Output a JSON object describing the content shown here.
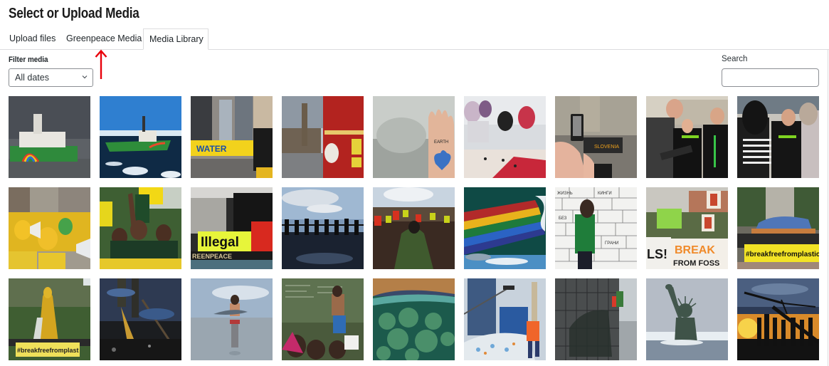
{
  "modal": {
    "title": "Select or Upload Media"
  },
  "tabs": [
    {
      "label": "Upload files",
      "active": false
    },
    {
      "label": "Greenpeace Media",
      "active": false
    },
    {
      "label": "Media Library",
      "active": true
    }
  ],
  "filter": {
    "label": "Filter media",
    "date_select_value": "All dates"
  },
  "search": {
    "label": "Search",
    "value": "",
    "placeholder": ""
  },
  "annotation": {
    "type": "red-arrow-up",
    "points_to": "Greenpeace Media",
    "color": "#e8000b"
  },
  "media_items": [
    {
      "row": 1,
      "col": 1,
      "description": "Greenpeace ship with rainbow hull in harbor under grey sky"
    },
    {
      "row": 1,
      "col": 2,
      "description": "Green Greenpeace ship among Arctic sea ice, blue sky"
    },
    {
      "row": 1,
      "col": 3,
      "description": "City street protest with yellow 'Water is Life' banner"
    },
    {
      "row": 1,
      "col": 4,
      "description": "Big Ben with red London bus and polar bear costume"
    },
    {
      "row": 1,
      "col": 5,
      "description": "Raised palm with 'Planet Earth First' and heart globe drawing"
    },
    {
      "row": 1,
      "col": 6,
      "description": "Women in hijabs working on a large fabric banner"
    },
    {
      "row": 1,
      "col": 7,
      "description": "Hands holding phone photographing protest banner"
    },
    {
      "row": 1,
      "col": 8,
      "description": "Man signing petition with Greenpeace volunteers in black shirts"
    },
    {
      "row": 1,
      "col": 9,
      "description": "Volunteer in Greenpeace shirt collecting signatures"
    },
    {
      "row": 2,
      "col": 1,
      "description": "Protesters in yellow suits with megaphones and barrels"
    },
    {
      "row": 2,
      "col": 2,
      "description": "Young activists cheering at climate march with yellow banner"
    },
    {
      "row": 2,
      "col": 3,
      "description": "Activists with 'Illegal' banner and Greenpeace boom on ship"
    },
    {
      "row": 2,
      "col": 4,
      "description": "Silhouetted people holding hands reflected in water"
    },
    {
      "row": 2,
      "col": 5,
      "description": "Crowd with red and yellow flags at rally"
    },
    {
      "row": 2,
      "col": 6,
      "description": "Rainbow stripes on ship hull with dolphins in waves"
    },
    {
      "row": 2,
      "col": 7,
      "description": "Volunteer in green shirt writing on whiteboard wall"
    },
    {
      "row": 2,
      "col": 8,
      "description": "Protest with 'Break Free From Fossil' banner"
    },
    {
      "row": 2,
      "col": 9,
      "description": "#breakfreefromplastic banner at temple steps"
    },
    {
      "row": 3,
      "col": 1,
      "description": "Golden statue at Batu Caves with #breakfreefromplastic banner"
    },
    {
      "row": 3,
      "col": 2,
      "description": "Oil-polluted water with reflection of legs"
    },
    {
      "row": 3,
      "col": 3,
      "description": "Child holding a fish standing in shallow sea"
    },
    {
      "row": 3,
      "col": 4,
      "description": "Teacher at chalkboard with students raising hands"
    },
    {
      "row": 3,
      "col": 5,
      "description": "Split-level view of coral reef under sunset sky"
    },
    {
      "row": 3,
      "col": 6,
      "description": "Woman dragging a huge sack of plastic bottles in city"
    },
    {
      "row": 3,
      "col": 7,
      "description": "Climbers rappelling down a tall building facade"
    },
    {
      "row": 3,
      "col": 8,
      "description": "Statue of Liberty partially submerged in icy water"
    },
    {
      "row": 3,
      "col": 9,
      "description": "Silhouettes raising a wind turbine at sunset"
    }
  ]
}
